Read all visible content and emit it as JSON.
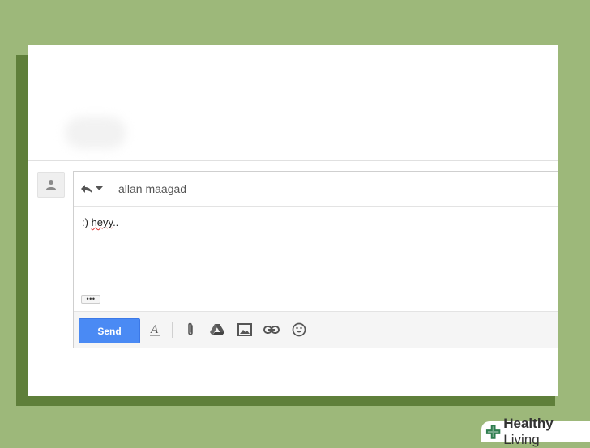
{
  "message": {
    "recipient": "allan maagad",
    "body_prefix": ":) ",
    "body_word": "heyy",
    "body_suffix": ".."
  },
  "toolbar": {
    "send_label": "Send",
    "icons": [
      "format-text-icon",
      "attach-icon",
      "drive-icon",
      "photo-icon",
      "link-icon",
      "emoji-icon"
    ]
  },
  "more_label": "•••",
  "watermark": {
    "brand_part1": "Healthy",
    "brand_part2": " Living"
  },
  "colors": {
    "background": "#9db87a",
    "shadow": "#5f7f3a",
    "send_button": "#4a8af4",
    "logo_green": "#2f7d4f"
  }
}
